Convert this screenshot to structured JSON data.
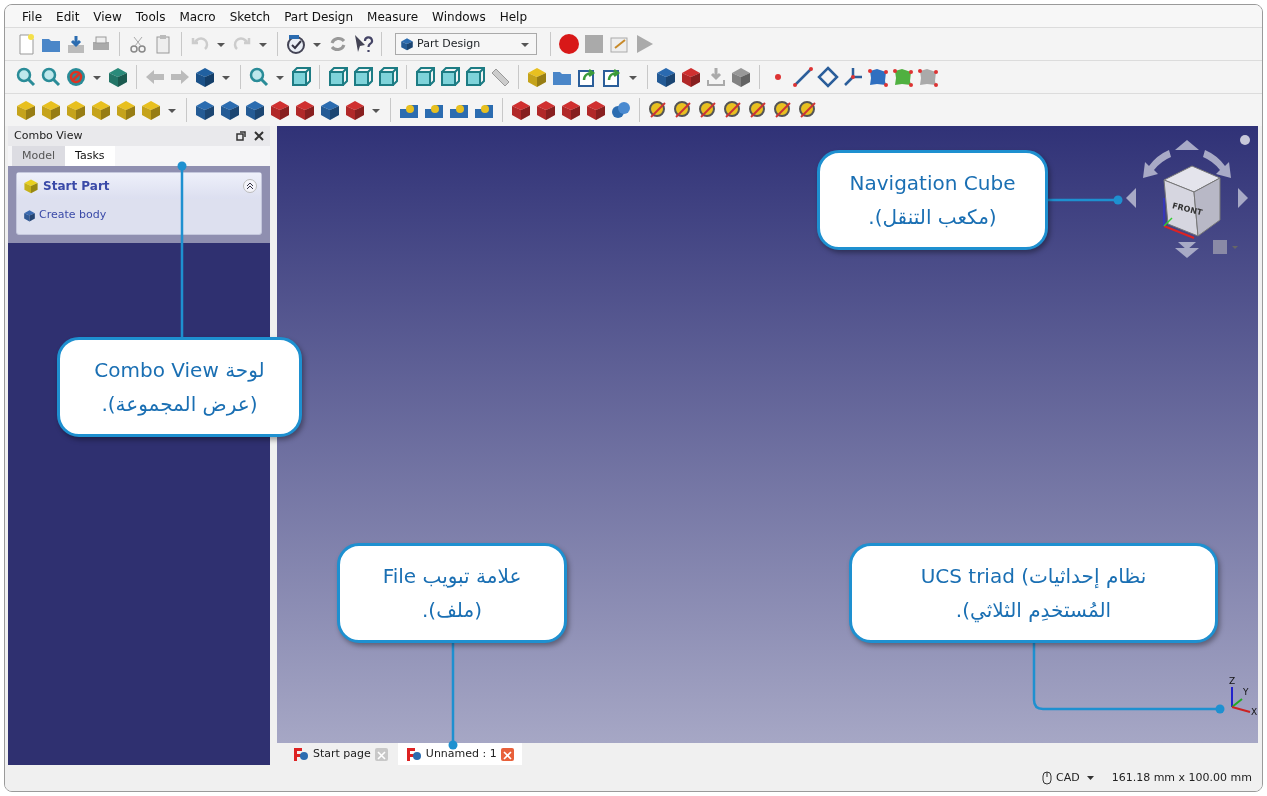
{
  "menu": [
    "File",
    "Edit",
    "View",
    "Tools",
    "Macro",
    "Sketch",
    "Part Design",
    "Measure",
    "Windows",
    "Help"
  ],
  "workbench_selector": {
    "value": "Part Design"
  },
  "combo_view": {
    "title": "Combo View",
    "tabs": [
      {
        "label": "Model",
        "selected": false
      },
      {
        "label": "Tasks",
        "selected": true
      }
    ],
    "task_panel": {
      "title": "Start Part",
      "actions": [
        "Create body"
      ]
    }
  },
  "navigation_cube": {
    "face_label": "FRONT"
  },
  "ucs_triad": {
    "axes": [
      "Z",
      "Y",
      "X"
    ]
  },
  "document_tabs": [
    {
      "label": "Start page",
      "selected": false
    },
    {
      "label": "Unnamed : 1",
      "selected": true
    }
  ],
  "status_bar": {
    "navigation_style": "CAD",
    "dimensions": "161.18 mm x 100.00 mm"
  },
  "callouts": [
    {
      "lines": [
        "Navigation Cube",
        "(مكعب التنقل)."
      ]
    },
    {
      "lines": [
        "لوحة Combo View",
        "(عرض المجموعة)."
      ]
    },
    {
      "lines": [
        "UCS triad (نظام إحداثيات",
        "المُستخدِم الثلاثي)."
      ]
    },
    {
      "lines": [
        "علامة تبويب File",
        "(ملف)."
      ]
    }
  ]
}
